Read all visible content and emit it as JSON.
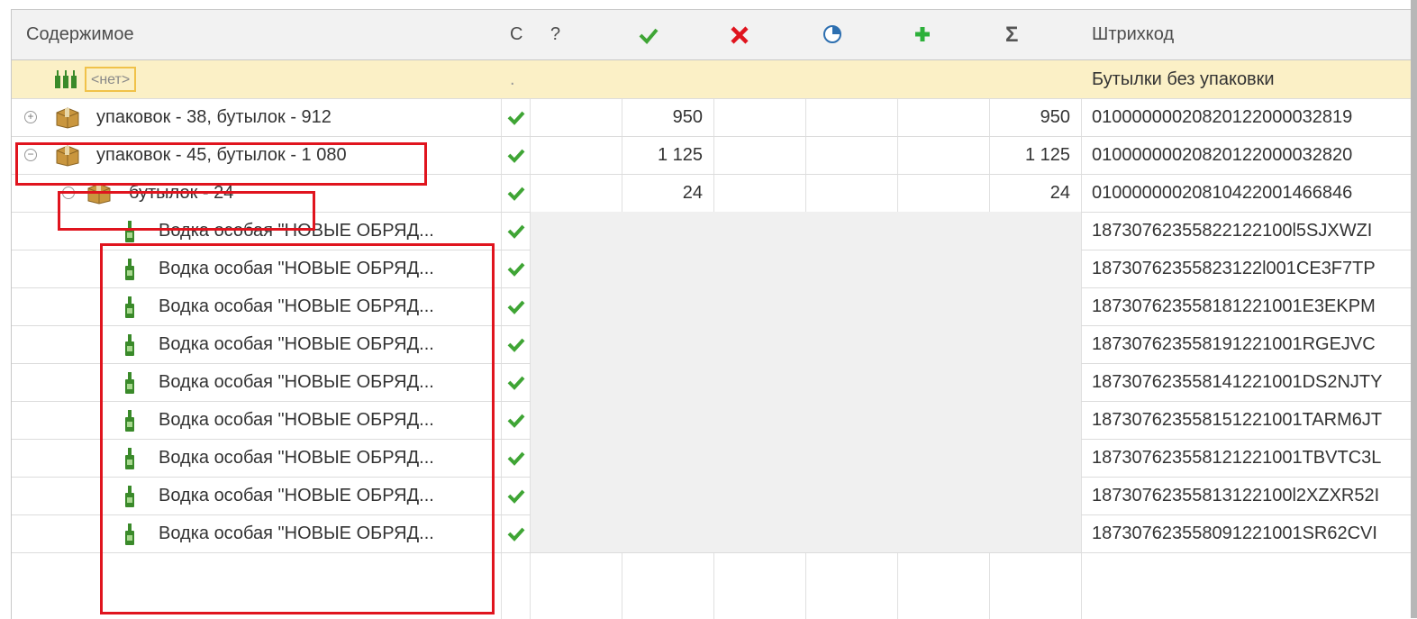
{
  "columns": {
    "content": "Содержимое",
    "c": "С",
    "question": "?",
    "ok_icon": "check-icon",
    "error_icon": "cross-icon",
    "partial_icon": "pie-icon",
    "add_icon": "plus-icon",
    "sum": "Σ",
    "barcode": "Штрихкод"
  },
  "colors": {
    "accent_yellow": "#fbf0c6",
    "check_green": "#3fa535",
    "cross_red": "#e0141e",
    "plus_green": "#2db03a"
  },
  "rows": [
    {
      "label": "<нет>",
      "c": ".",
      "ok": "",
      "sum": "",
      "barcode": "Бутылки без упаковки"
    },
    {
      "label": "упаковок - 38, бутылок - 912",
      "ok": "950",
      "sum": "950",
      "barcode": "01000000020820122000032819"
    },
    {
      "label": "упаковок - 45, бутылок - 1 080",
      "ok": "1 125",
      "sum": "1 125",
      "barcode": "01000000020820122000032820"
    },
    {
      "label": "бутылок -  24",
      "ok": "24",
      "sum": "24",
      "barcode": "01000000020810422001466846"
    },
    {
      "label": "Водка особая \"НОВЫЕ ОБРЯД...",
      "barcode": "18730762355822122100l5SJXWZI"
    },
    {
      "label": "Водка особая \"НОВЫЕ ОБРЯД...",
      "barcode": "18730762355823122l001CE3F7TP"
    },
    {
      "label": "Водка особая \"НОВЫЕ ОБРЯД...",
      "barcode": "187307623558181221001E3EKPM"
    },
    {
      "label": "Водка особая \"НОВЫЕ ОБРЯД...",
      "barcode": "187307623558191221001RGEJVC"
    },
    {
      "label": "Водка особая \"НОВЫЕ ОБРЯД...",
      "barcode": "187307623558141221001DS2NJTY"
    },
    {
      "label": "Водка особая \"НОВЫЕ ОБРЯД...",
      "barcode": "187307623558151221001TARM6JT"
    },
    {
      "label": "Водка особая \"НОВЫЕ ОБРЯД...",
      "barcode": "187307623558121221001TBVTC3L"
    },
    {
      "label": "Водка особая \"НОВЫЕ ОБРЯД...",
      "barcode": "18730762355813122100l2XZXR52I"
    },
    {
      "label": "Водка особая \"НОВЫЕ ОБРЯД...",
      "barcode": "187307623558091221001SR62CVI"
    }
  ]
}
